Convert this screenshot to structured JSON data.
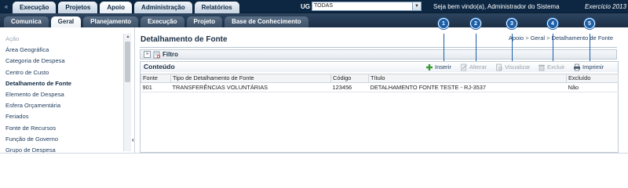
{
  "topnav": {
    "home_icon": "double-chevron-icon",
    "tabs": [
      {
        "label": "Execução"
      },
      {
        "label": "Projetos"
      },
      {
        "label": "Apoio"
      },
      {
        "label": "Administração"
      },
      {
        "label": "Relatórios"
      }
    ],
    "active_tab": "Apoio"
  },
  "ug": {
    "label": "UG",
    "value": "TODAS"
  },
  "welcome_text": "Seja bem vindo(a), Administrador do Sistema",
  "exercicio_text": "Exercício 2013",
  "subnav": {
    "tabs": [
      {
        "label": "Comunica"
      },
      {
        "label": "Geral"
      },
      {
        "label": "Planejamento"
      },
      {
        "label": "Execução"
      },
      {
        "label": "Projeto"
      },
      {
        "label": "Base de Conhecimento"
      }
    ],
    "active_tab": "Geral"
  },
  "sidebar": {
    "items": [
      {
        "label": "Ação",
        "state": "muted"
      },
      {
        "label": "Área Geográfica",
        "state": "normal"
      },
      {
        "label": "Categoria de Despesa",
        "state": "normal"
      },
      {
        "label": "Centro de Custo",
        "state": "normal"
      },
      {
        "label": "Detalhamento de Fonte",
        "state": "active"
      },
      {
        "label": "Elemento de Despesa",
        "state": "normal"
      },
      {
        "label": "Esfera Orçamentária",
        "state": "normal"
      },
      {
        "label": "Feriados",
        "state": "normal"
      },
      {
        "label": "Fonte de Recursos",
        "state": "normal"
      },
      {
        "label": "Função de Governo",
        "state": "normal"
      },
      {
        "label": "Grupo de Despesa",
        "state": "normal"
      }
    ]
  },
  "page": {
    "title": "Detalhamento de Fonte",
    "breadcrumb": [
      "Apoio",
      "Geral",
      "Detalhamento de Fonte"
    ],
    "breadcrumb_sep": ">"
  },
  "filter": {
    "toggle": "»",
    "label": "Filtro"
  },
  "panel": {
    "title": "Conteúdo"
  },
  "toolbar": {
    "insert_label": "Inserir",
    "edit_label": "Alterar",
    "view_label": "Visualizar",
    "delete_label": "Excluir",
    "print_label": "Imprimir"
  },
  "badges": [
    "1",
    "2",
    "3",
    "4",
    "5"
  ],
  "badge_color": "#1b5fa8",
  "table": {
    "columns": [
      "Fonte",
      "Tipo de Detalhamento de Fonte",
      "Código",
      "Título",
      "Excluído"
    ],
    "rows": [
      [
        "901",
        "TRANSFERÊNCIAS VOLUNTÁRIAS",
        "123456",
        "DETALHAMENTO FONTE TESTE - RJ-3537",
        "Não"
      ]
    ]
  },
  "colors": {
    "topbar": "#0d2742",
    "subbar": "#1b2f46",
    "accent": "#1b5fa8"
  }
}
